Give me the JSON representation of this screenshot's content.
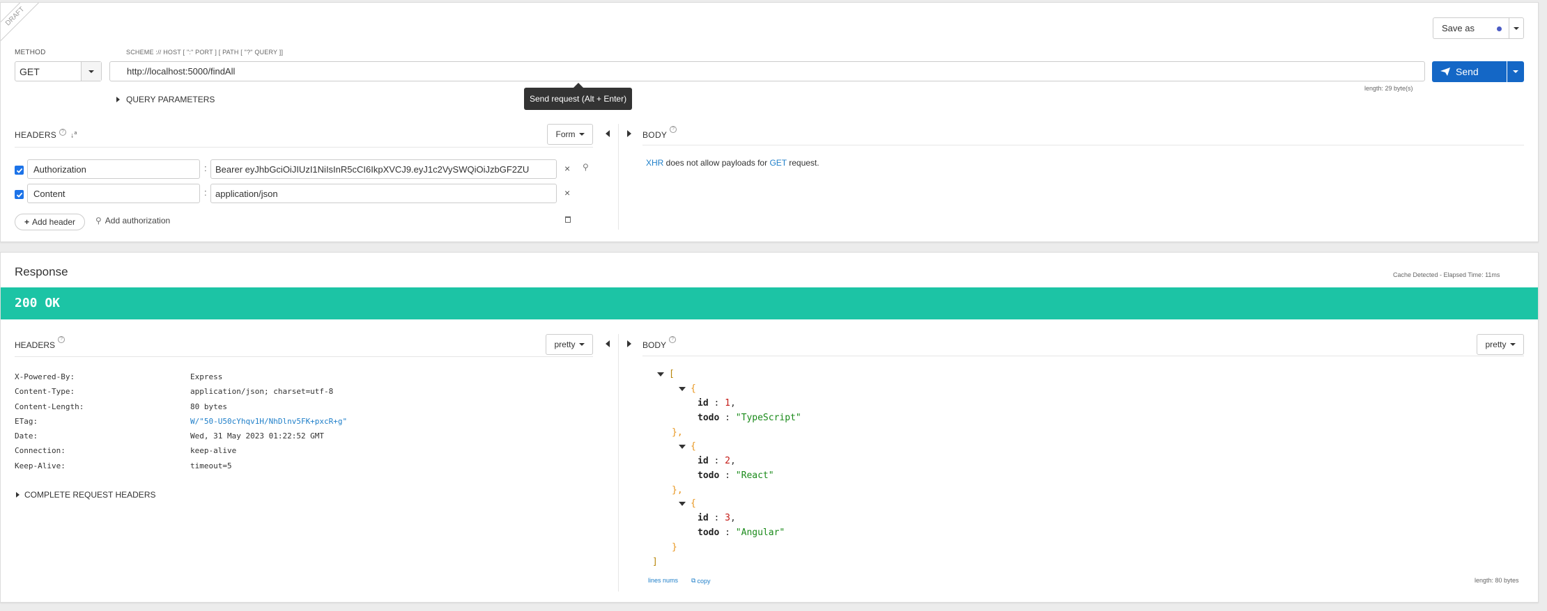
{
  "request": {
    "draft_label": "DRAFT",
    "save_as_label": "Save as",
    "method_label": "METHOD",
    "method_value": "GET",
    "url_hint": "SCHEME :// HOST [ \":\" PORT ] [ PATH [ \"?\" QUERY ]]",
    "url_value": "http://localhost:5000/findAll",
    "send_label": "Send",
    "tooltip": "Send request (Alt + Enter)",
    "url_length": "length: 29 byte(s)",
    "query_params_label": "QUERY PARAMETERS",
    "headers_label": "HEADERS",
    "form_label": "Form",
    "headers": [
      {
        "name": "Authorization",
        "value": "Bearer eyJhbGciOiJIUzI1NiIsInR5cCI6IkpXVCJ9.eyJ1c2VySWQiOiJzbGF2ZU"
      },
      {
        "name": "Content",
        "value": "application/json"
      }
    ],
    "add_header_label": "Add header",
    "add_auth_label": "Add authorization",
    "body_label": "BODY",
    "body_note": {
      "xhr": "XHR",
      "middle": " does not allow payloads for ",
      "method": "GET",
      "end": " request."
    }
  },
  "response": {
    "title": "Response",
    "cache_info": "Cache Detected - Elapsed Time: 11ms",
    "status": "200 OK",
    "status_color": "#1cc4a5",
    "headers_label": "HEADERS",
    "pretty_label": "pretty",
    "headers": [
      {
        "name": "X-Powered-By:",
        "value": "Express"
      },
      {
        "name": "Content-Type:",
        "value": "application/json; charset=utf-8"
      },
      {
        "name": "Content-Length:",
        "value": "80 bytes"
      },
      {
        "name": "ETag:",
        "value": "W/\"50-U50cYhqv1H/NhDlnv5FK+pxcR+g\""
      },
      {
        "name": "Date:",
        "value": "Wed, 31 May 2023 01:22:52 GMT"
      },
      {
        "name": "Connection:",
        "value": "keep-alive"
      },
      {
        "name": "Keep-Alive:",
        "value": "timeout=5"
      }
    ],
    "complete_headers_label": "COMPLETE REQUEST HEADERS",
    "body_label": "BODY",
    "body_items": [
      {
        "id": "1",
        "todo": "\"TypeScript\""
      },
      {
        "id": "2",
        "todo": "\"React\""
      },
      {
        "id": "3",
        "todo": "\"Angular\""
      }
    ],
    "json_tokens": {
      "open_bracket": "[",
      "close_bracket": "]",
      "open_brace": "{",
      "close_brace_comma": "},",
      "close_brace": "}",
      "id_key": "id",
      "todo_key": "todo",
      "colon": ":",
      "comma": ","
    },
    "lines_nums_label": "lines nums",
    "copy_label": "copy",
    "body_length": "length: 80 bytes"
  }
}
